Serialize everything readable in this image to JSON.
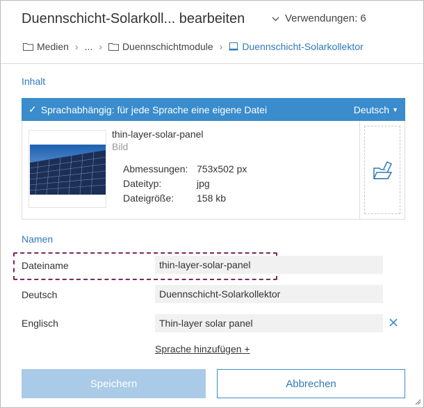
{
  "header": {
    "title": "Duennschicht-Solarkoll... bearbeiten",
    "usages": "Verwendungen: 6"
  },
  "breadcrumb": {
    "items": [
      "Medien",
      "...",
      "Duennschichtmodule",
      "Duennschicht-Solarkollektor"
    ]
  },
  "content": {
    "section_label": "Inhalt",
    "language_bar": {
      "text": "Sprachabhängig: für jede Sprache eine eigene Datei",
      "language": "Deutsch"
    },
    "file": {
      "name": "thin-layer-solar-panel",
      "kind": "Bild",
      "dimensions_label": "Abmessungen:",
      "dimensions_value": "753x502 px",
      "type_label": "Dateityp:",
      "type_value": "jpg",
      "size_label": "Dateigröße:",
      "size_value": "158 kb"
    }
  },
  "names": {
    "section_label": "Namen",
    "rows": [
      {
        "label": "Dateiname",
        "value": "thin-layer-solar-panel"
      },
      {
        "label": "Deutsch",
        "value": "Duennschicht-Solarkollektor"
      },
      {
        "label": "Englisch",
        "value": "Thin-layer solar panel"
      }
    ],
    "add_language": "Sprache hinzufügen +"
  },
  "buttons": {
    "save": "Speichern",
    "cancel": "Abbrechen"
  },
  "colors": {
    "accent": "#3a8ccc",
    "link": "#2f79b9",
    "save_disabled": "#a9cbe8",
    "highlight": "#7a2858"
  }
}
